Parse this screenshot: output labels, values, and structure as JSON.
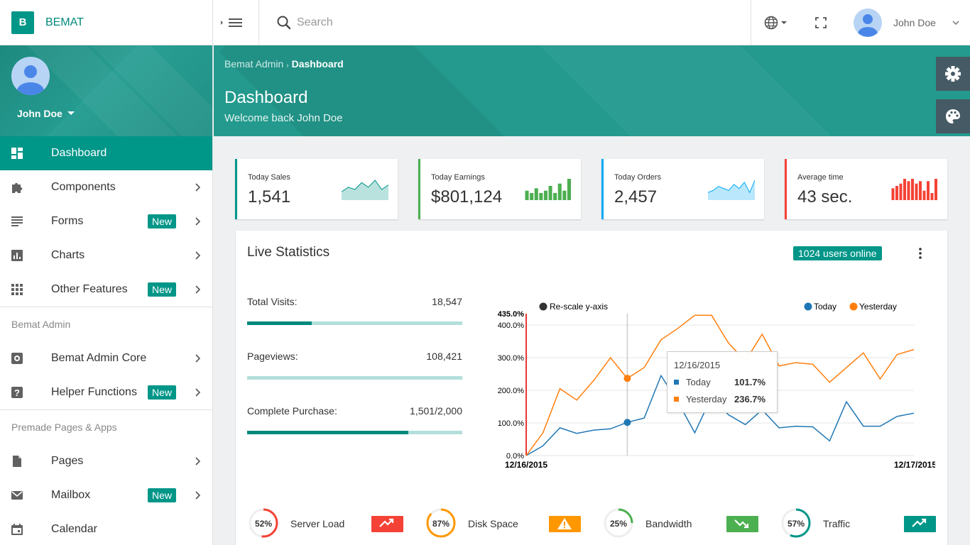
{
  "brand": {
    "logo_letter": "B",
    "name": "BEMAT"
  },
  "topbar": {
    "search_placeholder": "Search",
    "user_name": "John Doe",
    "icons": [
      "menu-icon",
      "search-icon",
      "globe-icon",
      "fullscreen-icon",
      "chevron-down-icon"
    ]
  },
  "sidebar": {
    "user_name": "John Doe",
    "items_main": [
      {
        "label": "Dashboard",
        "icon": "dashboard-icon",
        "active": true
      },
      {
        "label": "Components",
        "icon": "puzzle-icon"
      },
      {
        "label": "Forms",
        "icon": "form-icon",
        "badge": "New"
      },
      {
        "label": "Charts",
        "icon": "chart-icon"
      },
      {
        "label": "Other Features",
        "icon": "grid-icon",
        "badge": "New"
      }
    ],
    "section_admin": "Bemat Admin",
    "items_admin": [
      {
        "label": "Bemat Admin Core",
        "icon": "settings-box-icon"
      },
      {
        "label": "Helper Functions",
        "icon": "help-box-icon",
        "badge": "New"
      }
    ],
    "section_pages": "Premade Pages & Apps",
    "items_pages": [
      {
        "label": "Pages",
        "icon": "file-icon"
      },
      {
        "label": "Mailbox",
        "icon": "mail-icon",
        "badge": "New"
      },
      {
        "label": "Calendar",
        "icon": "calendar-icon"
      }
    ]
  },
  "header": {
    "breadcrumb_root": "Bemat Admin",
    "breadcrumb_current": "Dashboard",
    "title": "Dashboard",
    "subtitle": "Welcome back John Doe"
  },
  "stats": [
    {
      "label": "Today Sales",
      "value": "1,541",
      "color": "#009688",
      "spark": "area",
      "spark_color": "#80cbc4",
      "spark_values": [
        3,
        5,
        4,
        7,
        5,
        8,
        4,
        6
      ]
    },
    {
      "label": "Today Earnings",
      "value": "$801,124",
      "color": "#4caf50",
      "spark": "bar",
      "spark_color": "#4caf50",
      "spark_values": [
        4,
        3,
        5,
        3,
        4,
        6,
        3,
        7,
        4,
        9
      ]
    },
    {
      "label": "Today Orders",
      "value": "2,457",
      "color": "#03a9f4",
      "spark": "area",
      "spark_color": "#81d4fa",
      "spark_values": [
        3,
        4,
        6,
        5,
        4,
        7,
        5,
        8,
        3,
        9
      ]
    },
    {
      "label": "Average time",
      "value": "43 sec.",
      "color": "#f44336",
      "spark": "bar",
      "spark_color": "#f44336",
      "spark_values": [
        5,
        6,
        7,
        9,
        8,
        9,
        7,
        8,
        4,
        8,
        3,
        9
      ]
    }
  ],
  "live": {
    "title": "Live Statistics",
    "online": "1024 users online",
    "metrics": [
      {
        "label": "Total Visits:",
        "value": "18,547",
        "fill": 0.3
      },
      {
        "label": "Pageviews:",
        "value": "108,421",
        "fill": 0
      },
      {
        "label": "Complete Purchase:",
        "value": "1,501/2,000",
        "fill": 0.75
      }
    ]
  },
  "chart_data": {
    "type": "line",
    "rescale_label": "Re-scale y-axis",
    "x_start": "12/16/2015",
    "x_end": "12/17/2015",
    "y_ticks": [
      "0.0%",
      "100.0%",
      "200.0%",
      "300.0%",
      "400.0%"
    ],
    "y_max_label": "435.0%",
    "ylim": [
      0,
      435
    ],
    "series": [
      {
        "name": "Today",
        "color": "#1f77b4",
        "values": [
          0,
          30,
          85,
          68,
          78,
          82,
          101.7,
          115,
          245,
          165,
          70,
          180,
          125,
          95,
          140,
          85,
          90,
          88,
          45,
          165,
          90,
          90,
          120,
          130
        ]
      },
      {
        "name": "Yesterday",
        "color": "#ff7f0e",
        "values": [
          0,
          70,
          205,
          170,
          230,
          300,
          236.7,
          270,
          355,
          390,
          430,
          430,
          345,
          290,
          372,
          275,
          285,
          280,
          225,
          270,
          315,
          235,
          310,
          325
        ]
      }
    ],
    "tooltip": {
      "date": "12/16/2015",
      "rows": [
        {
          "name": "Today",
          "value": "101.7%"
        },
        {
          "name": "Yesterday",
          "value": "236.7%"
        }
      ],
      "index": 6
    }
  },
  "gauges": [
    {
      "pct": "52%",
      "value": 0.52,
      "name": "Server Load",
      "color": "#f44336",
      "badge_icon": "trending-up-icon"
    },
    {
      "pct": "87%",
      "value": 0.87,
      "name": "Disk Space",
      "color": "#ff9800",
      "badge_icon": "warning-icon"
    },
    {
      "pct": "25%",
      "value": 0.25,
      "name": "Bandwidth",
      "color": "#4caf50",
      "badge_icon": "trending-down-icon"
    },
    {
      "pct": "57%",
      "value": 0.57,
      "name": "Traffic",
      "color": "#009688",
      "badge_icon": "trending-up-icon"
    }
  ]
}
